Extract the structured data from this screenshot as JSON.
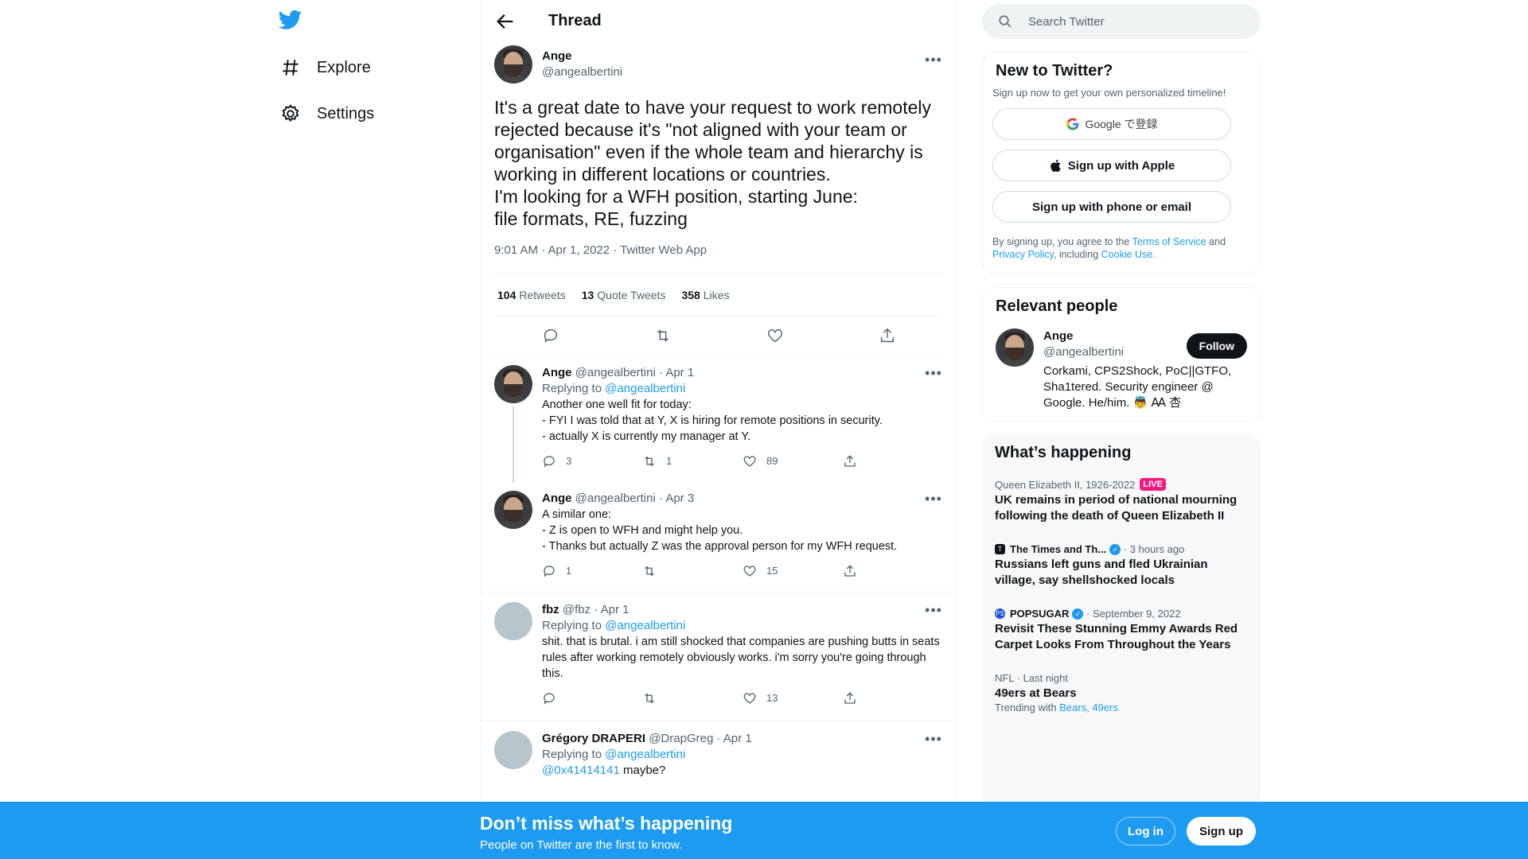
{
  "nav": {
    "explore": "Explore",
    "settings": "Settings"
  },
  "header": {
    "title": "Thread"
  },
  "main_tweet": {
    "name": "Ange",
    "handle": "@angealbertini",
    "text": "It's a great date to have your request to work remotely rejected because it's \"not aligned with your team or organisation\" even if the whole team and hierarchy is working in different locations or countries.\nI'm looking for a WFH position, starting June:\nfile formats, RE, fuzzing",
    "meta": "9:01 AM · Apr 1, 2022 · Twitter Web App",
    "retweets": "104",
    "retweets_label": "Retweets",
    "quotes": "13",
    "quotes_label": "Quote Tweets",
    "likes": "358",
    "likes_label": "Likes"
  },
  "replies": [
    {
      "name": "Ange",
      "handle": "@angealbertini",
      "date": "· Apr 1",
      "replying": "Replying to",
      "replying_to": "@angealbertini",
      "text": "Another one well fit for today:\n- FYI I was told that at Y, X is hiring for remote positions in security.\n- actually X is currently my manager at Y.",
      "replies": "3",
      "retweets": "1",
      "likes": "89"
    },
    {
      "name": "Ange",
      "handle": "@angealbertini",
      "date": "· Apr 3",
      "text": "A similar one:\n- Z is open to WFH and might help you.\n- Thanks but actually Z was the approval person for my WFH request.",
      "replies": "1",
      "retweets": "",
      "likes": "15"
    },
    {
      "name": "fbz",
      "handle": "@fbz",
      "date": "· Apr 1",
      "replying": "Replying to",
      "replying_to": "@angealbertini",
      "text": "shit. that is brutal. i am still shocked that companies are pushing butts in seats rules after working remotely obviously works. i'm sorry you're going through this.",
      "replies": "",
      "retweets": "",
      "likes": "13"
    },
    {
      "name": "Grégory DRAPERI",
      "handle": "@DrapGreg",
      "date": "· Apr 1",
      "replying": "Replying to",
      "replying_to": "@angealbertini",
      "mention": "@0x41414141",
      "text": "maybe?"
    }
  ],
  "search": {
    "placeholder": "Search Twitter"
  },
  "signup_card": {
    "title": "New to Twitter?",
    "subtitle": "Sign up now to get your own personalized timeline!",
    "google": "Google で登録",
    "apple": "Sign up with Apple",
    "phone": "Sign up with phone or email",
    "tos_1": "By signing up, you agree to the",
    "tos_link": "Terms of Service",
    "tos_2": "and",
    "privacy": "Privacy Policy",
    "tos_3": ", including",
    "cookie": "Cookie Use."
  },
  "relevant": {
    "title": "Relevant people",
    "name": "Ange",
    "handle": "@angealbertini",
    "follow": "Follow",
    "bio": "Corkami, CPS2Shock, PoC||GTFO, Sha1tered. Security engineer @ Google. He/him. 👼 Ꜳ 杏"
  },
  "trends": {
    "title": "What’s happening",
    "items": [
      {
        "context": "Queen Elizabeth II, 1926-2022",
        "badge": "LIVE",
        "title": "UK remains in period of national mourning following the death of Queen Elizabeth II"
      },
      {
        "source": "The Times and Th...",
        "time": "· 3 hours ago",
        "title": "Russians left guns and fled Ukrainian village, say shellshocked locals"
      },
      {
        "source": "POPSUGAR",
        "time": "· September 9, 2022",
        "title": "Revisit These Stunning Emmy Awards Red Carpet Looks From Throughout the Years"
      },
      {
        "context": "NFL · Last night",
        "title": "49ers at Bears",
        "trending": "Trending with",
        "trending_links": "Bears, 49ers"
      }
    ]
  },
  "banner": {
    "title": "Don’t miss what’s happening",
    "subtitle": "People on Twitter are the first to know.",
    "login": "Log in",
    "signup": "Sign up"
  }
}
